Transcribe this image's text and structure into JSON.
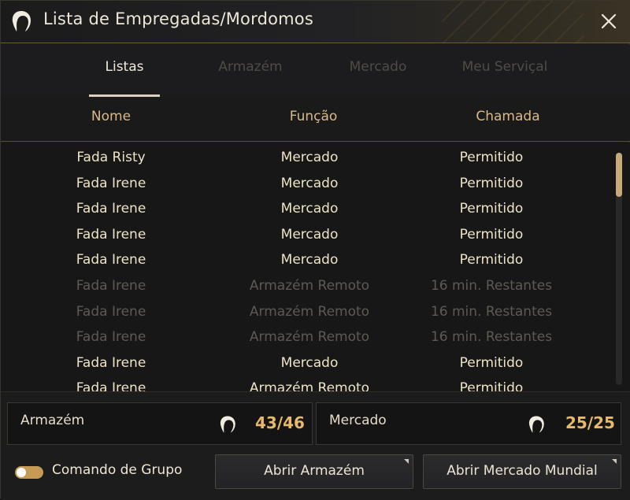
{
  "window": {
    "title": "Lista de Empregadas/Mordomos",
    "icon": "maid-icon",
    "close_icon": "close-icon"
  },
  "tabs": [
    {
      "label": "Listas",
      "active": true
    },
    {
      "label": "Armazém",
      "active": false
    },
    {
      "label": "Mercado",
      "active": false
    },
    {
      "label": "Meu Serviçal",
      "active": false
    }
  ],
  "columns": {
    "name": "Nome",
    "function": "Função",
    "call": "Chamada"
  },
  "rows": [
    {
      "name": "Fada Risty",
      "function": "Mercado",
      "call": "Permitido",
      "available": true
    },
    {
      "name": "Fada Irene",
      "function": "Mercado",
      "call": "Permitido",
      "available": true
    },
    {
      "name": "Fada Irene",
      "function": "Mercado",
      "call": "Permitido",
      "available": true
    },
    {
      "name": "Fada Irene",
      "function": "Mercado",
      "call": "Permitido",
      "available": true
    },
    {
      "name": "Fada Irene",
      "function": "Mercado",
      "call": "Permitido",
      "available": true
    },
    {
      "name": "Fada Irene",
      "function": "Armazém Remoto",
      "call": "16 min. Restantes",
      "available": false
    },
    {
      "name": "Fada Irene",
      "function": "Armazém Remoto",
      "call": "16 min. Restantes",
      "available": false
    },
    {
      "name": "Fada Irene",
      "function": "Armazém Remoto",
      "call": "16 min. Restantes",
      "available": false
    },
    {
      "name": "Fada Irene",
      "function": "Mercado",
      "call": "Permitido",
      "available": true
    },
    {
      "name": "Fada Irene",
      "function": "Armazém Remoto",
      "call": "Permitido",
      "available": true
    }
  ],
  "summary": {
    "warehouse": {
      "label": "Armazém",
      "value": "43/46",
      "icon": "maid-icon"
    },
    "market": {
      "label": "Mercado",
      "value": "25/25",
      "icon": "maid-icon"
    }
  },
  "group_command": {
    "label": "Comando de Grupo",
    "enabled": true
  },
  "buttons": {
    "open_warehouse": "Abrir Armazém",
    "open_market": "Abrir Mercado Mundial"
  },
  "colors": {
    "accent": "#e8b96a",
    "header": "#d9b98a",
    "toggle": "#c79a55"
  }
}
